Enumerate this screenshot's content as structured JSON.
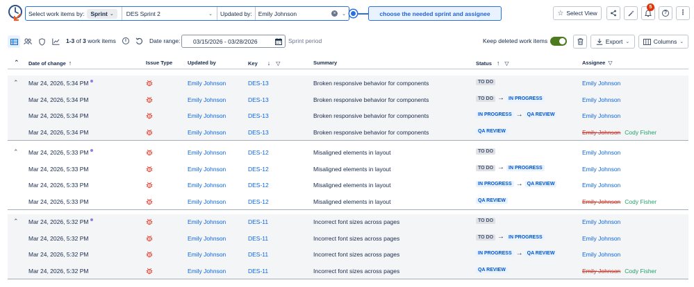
{
  "filter": {
    "select_label": "Select work items by:",
    "sprint_chip": "Sprint",
    "sprint_value": "DES Sprint 2",
    "updated_by_label": "Updated by:",
    "updated_by_value": "Emily Johnson"
  },
  "callout": "choose the needed sprint and assignee",
  "top_actions": {
    "select_view": "Select View",
    "notifications_count": "5"
  },
  "toolbar": {
    "count_prefix": "1-3",
    "count_of": "of",
    "count_total": "3",
    "count_suffix": "work items",
    "date_range_label": "Date range:",
    "date_range_value": "03/15/2026 - 03/28/2026",
    "sprint_period": "Sprint period",
    "keep_deleted_label": "Keep deleted work items",
    "keep_deleted_on": true,
    "export_label": "Export",
    "columns_label": "Columns"
  },
  "columns": {
    "date": "Date of change",
    "type": "Issue Type",
    "updated_by": "Updated by",
    "key": "Key",
    "summary": "Summary",
    "status": "Status",
    "assignee": "Assignee"
  },
  "groups": [
    {
      "key": "DES-13",
      "summary": "Broken responsive behavior for components",
      "rows": [
        {
          "date": "Mar 24, 2026, 5:34 PM",
          "updated_by": "Emily Johnson",
          "status_from": "TO DO",
          "status_to": "",
          "assignee_old": "",
          "assignee": "Emily Johnson"
        },
        {
          "date": "Mar 24, 2026, 5:34 PM",
          "updated_by": "Emily Johnson",
          "status_from": "TO DO",
          "status_to": "IN PROGRESS",
          "assignee_old": "",
          "assignee": "Emily Johnson"
        },
        {
          "date": "Mar 24, 2026, 5:34 PM",
          "updated_by": "Emily Johnson",
          "status_from": "IN PROGRESS",
          "status_to": "QA REVIEW",
          "assignee_old": "",
          "assignee": "Emily Johnson"
        },
        {
          "date": "Mar 24, 2026, 5:34 PM",
          "updated_by": "Emily Johnson",
          "status_from": "QA REVIEW",
          "status_to": "",
          "assignee_old": "Emily Johnson",
          "assignee": "Cody Fisher"
        }
      ]
    },
    {
      "key": "DES-12",
      "summary": "Misaligned elements in layout",
      "rows": [
        {
          "date": "Mar 24, 2026, 5:33 PM",
          "updated_by": "Emily Johnson",
          "status_from": "TO DO",
          "status_to": "",
          "assignee_old": "",
          "assignee": "Emily Johnson"
        },
        {
          "date": "Mar 24, 2026, 5:33 PM",
          "updated_by": "Emily Johnson",
          "status_from": "TO DO",
          "status_to": "IN PROGRESS",
          "assignee_old": "",
          "assignee": "Emily Johnson"
        },
        {
          "date": "Mar 24, 2026, 5:33 PM",
          "updated_by": "Emily Johnson",
          "status_from": "IN PROGRESS",
          "status_to": "QA REVIEW",
          "assignee_old": "",
          "assignee": "Emily Johnson"
        },
        {
          "date": "Mar 24, 2026, 5:33 PM",
          "updated_by": "Emily Johnson",
          "status_from": "QA REVIEW",
          "status_to": "",
          "assignee_old": "Emily Johnson",
          "assignee": "Cody Fisher"
        }
      ]
    },
    {
      "key": "DES-11",
      "summary": "Incorrect font sizes across pages",
      "rows": [
        {
          "date": "Mar 24, 2026, 5:32 PM",
          "updated_by": "Emily Johnson",
          "status_from": "TO DO",
          "status_to": "",
          "assignee_old": "",
          "assignee": "Emily Johnson"
        },
        {
          "date": "Mar 24, 2026, 5:32 PM",
          "updated_by": "Emily Johnson",
          "status_from": "TO DO",
          "status_to": "IN PROGRESS",
          "assignee_old": "",
          "assignee": "Emily Johnson"
        },
        {
          "date": "Mar 24, 2026, 5:32 PM",
          "updated_by": "Emily Johnson",
          "status_from": "IN PROGRESS",
          "status_to": "QA REVIEW",
          "assignee_old": "",
          "assignee": "Emily Johnson"
        },
        {
          "date": "Mar 24, 2026, 5:32 PM",
          "updated_by": "Emily Johnson",
          "status_from": "QA REVIEW",
          "status_to": "",
          "assignee_old": "Emily Johnson",
          "assignee": "Cody Fisher"
        }
      ]
    }
  ],
  "colors": {
    "accent": "#2a6fe0",
    "link": "#0c66e4",
    "removed": "#c9372c",
    "added": "#22a06b",
    "toggle_on": "#4d7a1f",
    "badge": "#de350b"
  }
}
